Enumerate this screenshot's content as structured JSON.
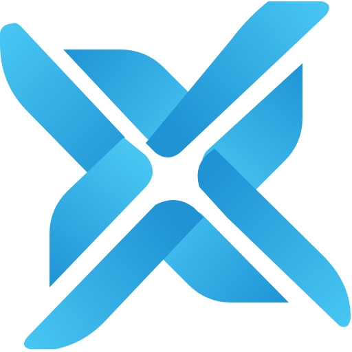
{
  "logo": {
    "icon": "x-pinwheel-logo-icon",
    "colors": {
      "background": "#ffffff",
      "blue_dark": "#1f93d4",
      "blue_mid": "#2aa6e3",
      "blue_light": "#47c6f2"
    }
  }
}
